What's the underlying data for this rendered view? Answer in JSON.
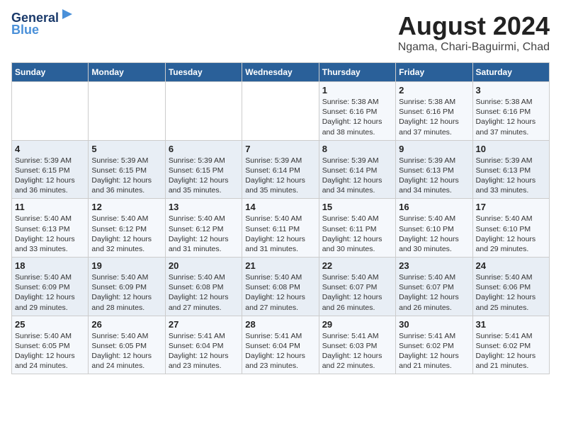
{
  "header": {
    "logo_line1": "General",
    "logo_line2": "Blue",
    "month_year": "August 2024",
    "location": "Ngama, Chari-Baguirmi, Chad"
  },
  "weekdays": [
    "Sunday",
    "Monday",
    "Tuesday",
    "Wednesday",
    "Thursday",
    "Friday",
    "Saturday"
  ],
  "weeks": [
    [
      {
        "day": "",
        "info": ""
      },
      {
        "day": "",
        "info": ""
      },
      {
        "day": "",
        "info": ""
      },
      {
        "day": "",
        "info": ""
      },
      {
        "day": "1",
        "info": "Sunrise: 5:38 AM\nSunset: 6:16 PM\nDaylight: 12 hours\nand 38 minutes."
      },
      {
        "day": "2",
        "info": "Sunrise: 5:38 AM\nSunset: 6:16 PM\nDaylight: 12 hours\nand 37 minutes."
      },
      {
        "day": "3",
        "info": "Sunrise: 5:38 AM\nSunset: 6:16 PM\nDaylight: 12 hours\nand 37 minutes."
      }
    ],
    [
      {
        "day": "4",
        "info": "Sunrise: 5:39 AM\nSunset: 6:15 PM\nDaylight: 12 hours\nand 36 minutes."
      },
      {
        "day": "5",
        "info": "Sunrise: 5:39 AM\nSunset: 6:15 PM\nDaylight: 12 hours\nand 36 minutes."
      },
      {
        "day": "6",
        "info": "Sunrise: 5:39 AM\nSunset: 6:15 PM\nDaylight: 12 hours\nand 35 minutes."
      },
      {
        "day": "7",
        "info": "Sunrise: 5:39 AM\nSunset: 6:14 PM\nDaylight: 12 hours\nand 35 minutes."
      },
      {
        "day": "8",
        "info": "Sunrise: 5:39 AM\nSunset: 6:14 PM\nDaylight: 12 hours\nand 34 minutes."
      },
      {
        "day": "9",
        "info": "Sunrise: 5:39 AM\nSunset: 6:13 PM\nDaylight: 12 hours\nand 34 minutes."
      },
      {
        "day": "10",
        "info": "Sunrise: 5:39 AM\nSunset: 6:13 PM\nDaylight: 12 hours\nand 33 minutes."
      }
    ],
    [
      {
        "day": "11",
        "info": "Sunrise: 5:40 AM\nSunset: 6:13 PM\nDaylight: 12 hours\nand 33 minutes."
      },
      {
        "day": "12",
        "info": "Sunrise: 5:40 AM\nSunset: 6:12 PM\nDaylight: 12 hours\nand 32 minutes."
      },
      {
        "day": "13",
        "info": "Sunrise: 5:40 AM\nSunset: 6:12 PM\nDaylight: 12 hours\nand 31 minutes."
      },
      {
        "day": "14",
        "info": "Sunrise: 5:40 AM\nSunset: 6:11 PM\nDaylight: 12 hours\nand 31 minutes."
      },
      {
        "day": "15",
        "info": "Sunrise: 5:40 AM\nSunset: 6:11 PM\nDaylight: 12 hours\nand 30 minutes."
      },
      {
        "day": "16",
        "info": "Sunrise: 5:40 AM\nSunset: 6:10 PM\nDaylight: 12 hours\nand 30 minutes."
      },
      {
        "day": "17",
        "info": "Sunrise: 5:40 AM\nSunset: 6:10 PM\nDaylight: 12 hours\nand 29 minutes."
      }
    ],
    [
      {
        "day": "18",
        "info": "Sunrise: 5:40 AM\nSunset: 6:09 PM\nDaylight: 12 hours\nand 29 minutes."
      },
      {
        "day": "19",
        "info": "Sunrise: 5:40 AM\nSunset: 6:09 PM\nDaylight: 12 hours\nand 28 minutes."
      },
      {
        "day": "20",
        "info": "Sunrise: 5:40 AM\nSunset: 6:08 PM\nDaylight: 12 hours\nand 27 minutes."
      },
      {
        "day": "21",
        "info": "Sunrise: 5:40 AM\nSunset: 6:08 PM\nDaylight: 12 hours\nand 27 minutes."
      },
      {
        "day": "22",
        "info": "Sunrise: 5:40 AM\nSunset: 6:07 PM\nDaylight: 12 hours\nand 26 minutes."
      },
      {
        "day": "23",
        "info": "Sunrise: 5:40 AM\nSunset: 6:07 PM\nDaylight: 12 hours\nand 26 minutes."
      },
      {
        "day": "24",
        "info": "Sunrise: 5:40 AM\nSunset: 6:06 PM\nDaylight: 12 hours\nand 25 minutes."
      }
    ],
    [
      {
        "day": "25",
        "info": "Sunrise: 5:40 AM\nSunset: 6:05 PM\nDaylight: 12 hours\nand 24 minutes."
      },
      {
        "day": "26",
        "info": "Sunrise: 5:40 AM\nSunset: 6:05 PM\nDaylight: 12 hours\nand 24 minutes."
      },
      {
        "day": "27",
        "info": "Sunrise: 5:41 AM\nSunset: 6:04 PM\nDaylight: 12 hours\nand 23 minutes."
      },
      {
        "day": "28",
        "info": "Sunrise: 5:41 AM\nSunset: 6:04 PM\nDaylight: 12 hours\nand 23 minutes."
      },
      {
        "day": "29",
        "info": "Sunrise: 5:41 AM\nSunset: 6:03 PM\nDaylight: 12 hours\nand 22 minutes."
      },
      {
        "day": "30",
        "info": "Sunrise: 5:41 AM\nSunset: 6:02 PM\nDaylight: 12 hours\nand 21 minutes."
      },
      {
        "day": "31",
        "info": "Sunrise: 5:41 AM\nSunset: 6:02 PM\nDaylight: 12 hours\nand 21 minutes."
      }
    ]
  ]
}
